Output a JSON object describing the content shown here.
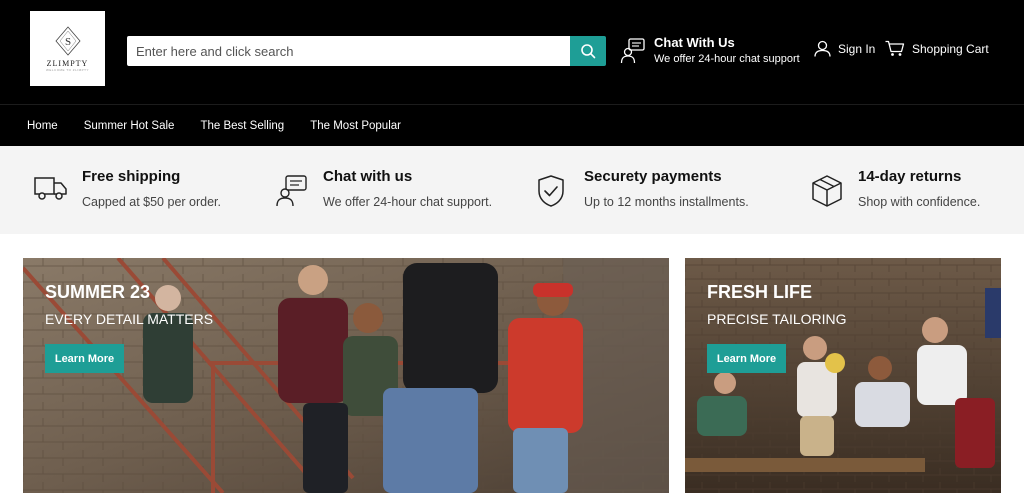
{
  "brand": {
    "name": "ZLIMPTY",
    "tagline": "WELCOME TO ZLIMPTY"
  },
  "search": {
    "placeholder": "Enter here and click search"
  },
  "header": {
    "chat_title": "Chat With Us",
    "chat_subtitle": "We offer 24-hour chat support",
    "signin_label": "Sign In",
    "cart_label": "Shopping Cart"
  },
  "nav": {
    "items": [
      "Home",
      "Summer Hot Sale",
      "The Best Selling",
      "The Most Popular"
    ]
  },
  "features": [
    {
      "title": "Free shipping",
      "text": "Capped at $50 per order.",
      "icon": "truck-icon"
    },
    {
      "title": "Chat with us",
      "text": "We offer 24-hour chat support.",
      "icon": "chat-support-icon"
    },
    {
      "title": "Securety payments",
      "text": "Up to 12 months installments.",
      "icon": "shield-check-icon"
    },
    {
      "title": "14-day returns",
      "text": "Shop with confidence.",
      "icon": "box-icon"
    }
  ],
  "banners": [
    {
      "title": "SUMMER 23",
      "subtitle": "EVERY DETAIL MATTERS",
      "button": "Learn More"
    },
    {
      "title": "FRESH LIFE",
      "subtitle": "PRECISE TAILORING",
      "button": "Learn More"
    }
  ],
  "colors": {
    "accent": "#1e9e96",
    "header_bg": "#000000",
    "features_bg": "#f4f4f4"
  }
}
